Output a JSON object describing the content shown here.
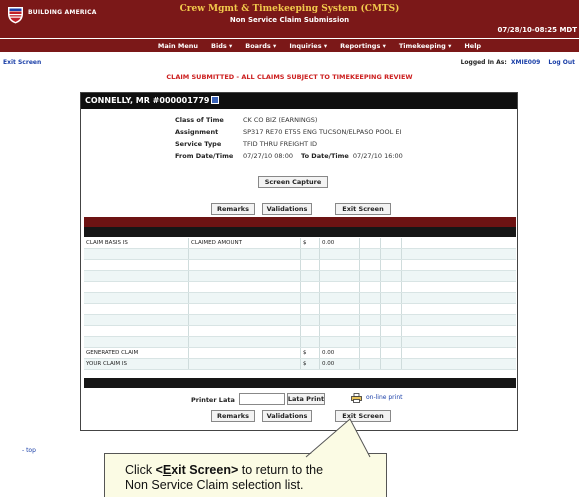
{
  "header": {
    "brand": "BUILDING AMERICA",
    "title": "Crew Mgmt & Timekeeping System (CMTS)",
    "subtitle": "Non Service Claim Submission",
    "datetime": "07/28/10-08:25 MDT"
  },
  "nav": {
    "items": [
      "Main Menu",
      "Bids ▾",
      "Boards ▾",
      "Inquiries ▾",
      "Reportings ▾",
      "Timekeeping ▾",
      "Help"
    ]
  },
  "session": {
    "exit_link": "Exit Screen",
    "logged_label": "Logged In As:",
    "user_id": "XMIE009",
    "logout": "Log Out"
  },
  "status_message": "CLAIM SUBMITTED - ALL CLAIMS SUBJECT TO TIMEKEEPING REVIEW",
  "panel": {
    "header_name": "CONNELLY, MR #000001779",
    "class_label": "Class of Time",
    "class_value": "CK CO BIZ (EARNINGS)",
    "assignment_label": "Assignment",
    "assignment_value": "SP317 RE70 ET55 ENG TUCSON/ELPASO POOL EI",
    "service_label": "Service Type",
    "service_value": "TFID THRU FREIGHT ID",
    "from_label": "From Date/Time",
    "from_value": "07/27/10 08:00",
    "to_label": "To Date/Time",
    "to_value": "07/27/10 16:00",
    "screen_capture": "Screen Capture",
    "remarks": "Remarks",
    "validations": "Validations",
    "exit_screen": "Exit Screen"
  },
  "grid": {
    "rows": [
      [
        "CLAIM BASIS IS",
        "CLAIMED AMOUNT",
        "$",
        "0.00",
        "",
        "",
        ""
      ],
      [
        "",
        "",
        "",
        "",
        "",
        "",
        ""
      ],
      [
        "",
        "",
        "",
        "",
        "",
        "",
        ""
      ],
      [
        "",
        "",
        "",
        "",
        "",
        "",
        ""
      ],
      [
        "",
        "",
        "",
        "",
        "",
        "",
        ""
      ],
      [
        "",
        "",
        "",
        "",
        "",
        "",
        ""
      ],
      [
        "",
        "",
        "",
        "",
        "",
        "",
        ""
      ],
      [
        "",
        "",
        "",
        "",
        "",
        "",
        ""
      ],
      [
        "",
        "",
        "",
        "",
        "",
        "",
        ""
      ],
      [
        "",
        "",
        "",
        "",
        "",
        "",
        ""
      ],
      [
        "GENERATED CLAIM",
        "",
        "$",
        "0.00",
        "",
        "",
        ""
      ],
      [
        "YOUR CLAIM IS",
        "",
        "$",
        "0.00",
        "",
        "",
        ""
      ]
    ]
  },
  "print": {
    "printer_label": "Printer Lata",
    "printer_value": "",
    "lata_print": "Lata Print",
    "online_print": "on-line print"
  },
  "footer": {
    "top_link": "top"
  },
  "callout": {
    "prefix": "Click ",
    "open": "<",
    "exit_underlined": "E",
    "exit_rest": "xit Screen",
    "close": ">",
    "middle": " to return to the",
    "line2": "Non Service Claim selection list."
  }
}
